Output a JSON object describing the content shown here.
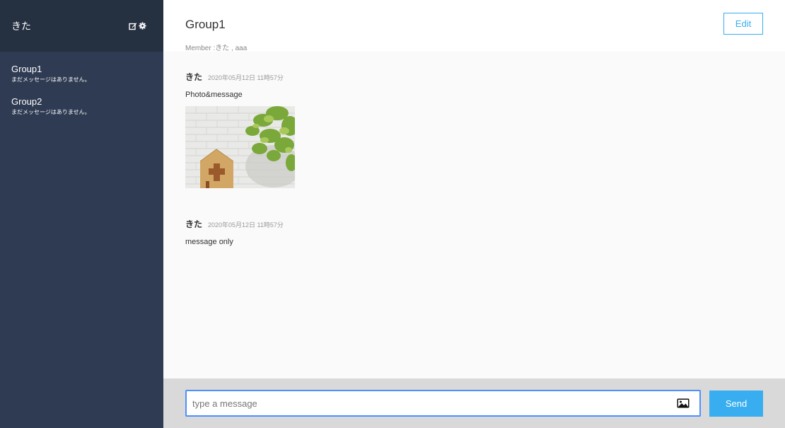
{
  "sidebar": {
    "user_name": "きた",
    "icons": [
      "edit-icon",
      "gear-icon"
    ],
    "groups": [
      {
        "name": "Group1",
        "last_message": "まだメッセージはありません。"
      },
      {
        "name": "Group2",
        "last_message": "まだメッセージはありません。"
      }
    ]
  },
  "chat": {
    "title": "Group1",
    "members": "Member :きた , aaa",
    "edit_label": "Edit",
    "messages": [
      {
        "user": "きた",
        "date": "2020年05月12日 11時57分",
        "text": "Photo&message",
        "has_image": true
      },
      {
        "user": "きた",
        "date": "2020年05月12日 11時57分",
        "text": "message only",
        "has_image": false
      }
    ]
  },
  "composer": {
    "placeholder": "type a message",
    "value": "",
    "image_icon": "image-icon",
    "send_label": "Send"
  },
  "colors": {
    "sidebar_bg": "#2e3b52",
    "sidebar_header_bg": "#253041",
    "accent": "#38aef0",
    "input_focus": "#4d90fe"
  }
}
